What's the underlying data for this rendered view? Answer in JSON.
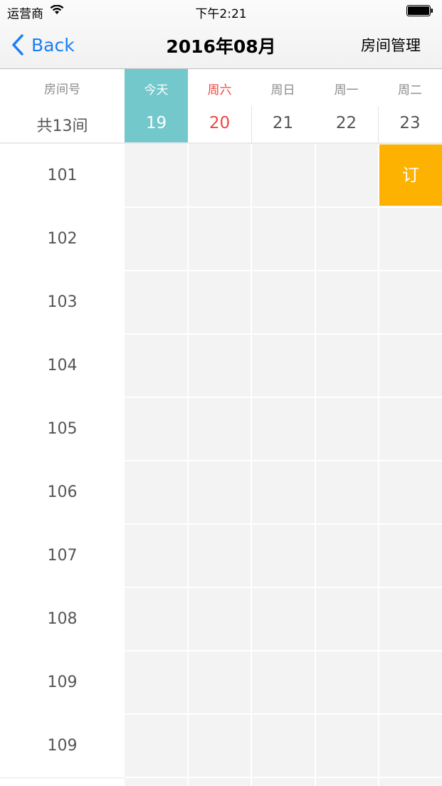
{
  "status_bar": {
    "carrier": "运营商",
    "time": "下午2:21",
    "icons": [
      "wifi-icon",
      "battery-icon"
    ]
  },
  "nav": {
    "back_label": "Back",
    "title": "2016年08月",
    "right_label": "房间管理"
  },
  "room_column": {
    "header": "房间号",
    "total": "共13间"
  },
  "days": [
    {
      "week": "今天",
      "date": "19",
      "state": "today"
    },
    {
      "week": "周六",
      "date": "20",
      "state": "weekend"
    },
    {
      "week": "周日",
      "date": "21",
      "state": "normal"
    },
    {
      "week": "周一",
      "date": "22",
      "state": "normal"
    },
    {
      "week": "周二",
      "date": "23",
      "state": "normal"
    }
  ],
  "rooms": [
    "101",
    "102",
    "103",
    "104",
    "105",
    "106",
    "107",
    "108",
    "109",
    "109"
  ],
  "booking": {
    "room": "101",
    "date": "23",
    "label": "订"
  },
  "colors": {
    "accent": "#1a7ef6",
    "today": "#72c8cb",
    "weekend": "#f0453f",
    "booked": "#fdb202",
    "cell": "#f3f3f3"
  }
}
